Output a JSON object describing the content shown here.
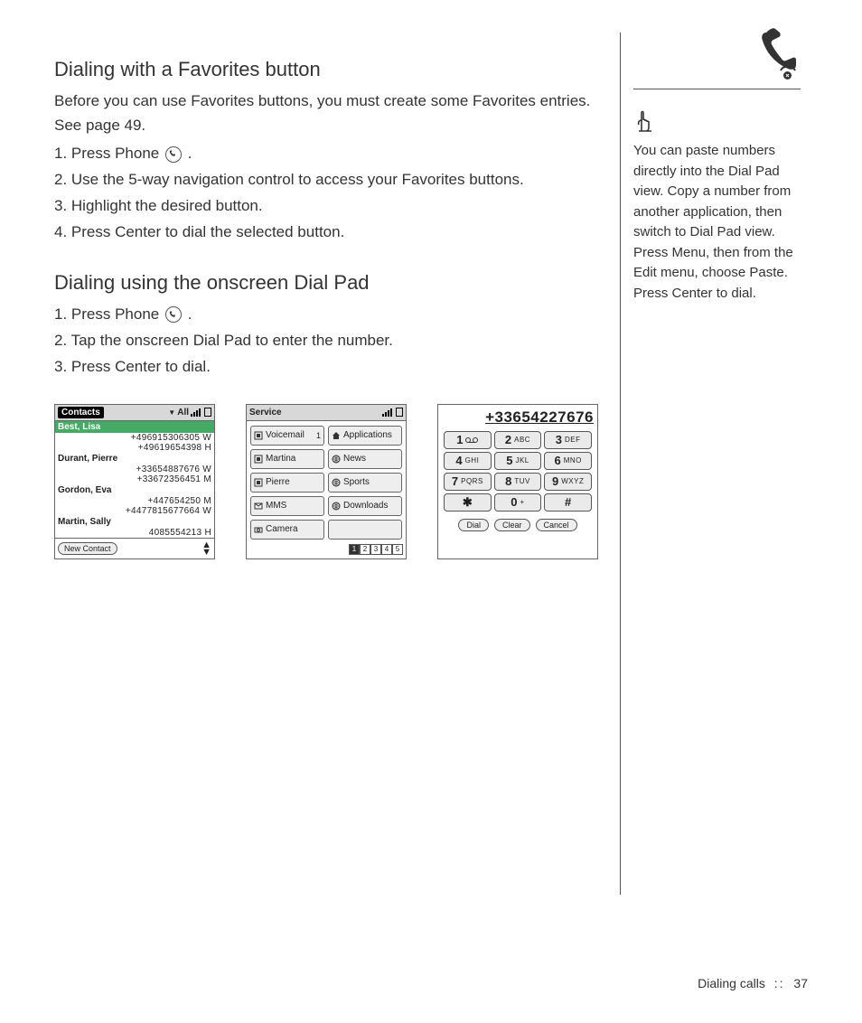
{
  "headings": {
    "favorites": "Dialing with a Favorites button",
    "dialpad": "Dialing using the onscreen Dial Pad"
  },
  "intro_favorites": "Before you can use Favorites buttons, you must create some Favorites entries. See page 49.",
  "steps_favorites": [
    "1.  Press Phone",
    "2.  Use the 5-way navigation control to access your Favorites buttons.",
    "3.  Highlight the desired button.",
    "4.  Press Center to dial the selected button."
  ],
  "steps_dialpad": [
    "1.  Press Phone",
    "2.  Tap the onscreen Dial Pad to enter the number.",
    "3.  Press Center to dial."
  ],
  "contacts_screen": {
    "header_tab": "Contacts",
    "header_filter": "All",
    "entries": [
      {
        "name": "Best, Lisa",
        "selected": true,
        "numbers": [
          "+496915306305 W",
          "+49619654398 H"
        ]
      },
      {
        "name": "Durant, Pierre",
        "selected": false,
        "numbers": [
          "+33654887676 W",
          "+33672356451 M"
        ]
      },
      {
        "name": "Gordon, Eva",
        "selected": false,
        "numbers": [
          "+447654250 M",
          "+4477815677664 W"
        ]
      },
      {
        "name": "Martin, Sally",
        "selected": false,
        "numbers": [
          "4085554213 H"
        ]
      }
    ],
    "new_contact": "New Contact"
  },
  "service_screen": {
    "header": "Service",
    "favorites": [
      {
        "label": "Voicemail",
        "badge": "1",
        "icon": "speed-dial"
      },
      {
        "label": "Applications",
        "icon": "home"
      },
      {
        "label": "Martina",
        "icon": "speed-dial"
      },
      {
        "label": "News",
        "icon": "globe"
      },
      {
        "label": "Pierre",
        "icon": "speed-dial"
      },
      {
        "label": "Sports",
        "icon": "globe"
      },
      {
        "label": "MMS",
        "icon": "msg"
      },
      {
        "label": "Downloads",
        "icon": "globe"
      },
      {
        "label": "Camera",
        "icon": "camera"
      },
      {
        "label": "",
        "icon": ""
      }
    ],
    "pages": [
      "1",
      "2",
      "3",
      "4",
      "5"
    ]
  },
  "dialpad_screen": {
    "number": "+33654227676",
    "keys": [
      {
        "d": "1",
        "s": "",
        "vm": true
      },
      {
        "d": "2",
        "s": "ABC"
      },
      {
        "d": "3",
        "s": "DEF"
      },
      {
        "d": "4",
        "s": "GHI"
      },
      {
        "d": "5",
        "s": "JKL"
      },
      {
        "d": "6",
        "s": "MNO"
      },
      {
        "d": "7",
        "s": "PQRS"
      },
      {
        "d": "8",
        "s": "TUV"
      },
      {
        "d": "9",
        "s": "WXYZ"
      },
      {
        "d": "✱",
        "s": ""
      },
      {
        "d": "0",
        "s": "+"
      },
      {
        "d": "#",
        "s": ""
      }
    ],
    "actions": [
      "Dial",
      "Clear",
      "Cancel"
    ]
  },
  "sidebar": {
    "tip": "You can paste numbers directly into the Dial Pad view. Copy a number from another application, then switch to Dial Pad view. Press Menu, then from the Edit menu, choose Paste. Press Center to dial."
  },
  "footer": {
    "section": "Dialing calls",
    "sep": "::",
    "page": "37"
  }
}
